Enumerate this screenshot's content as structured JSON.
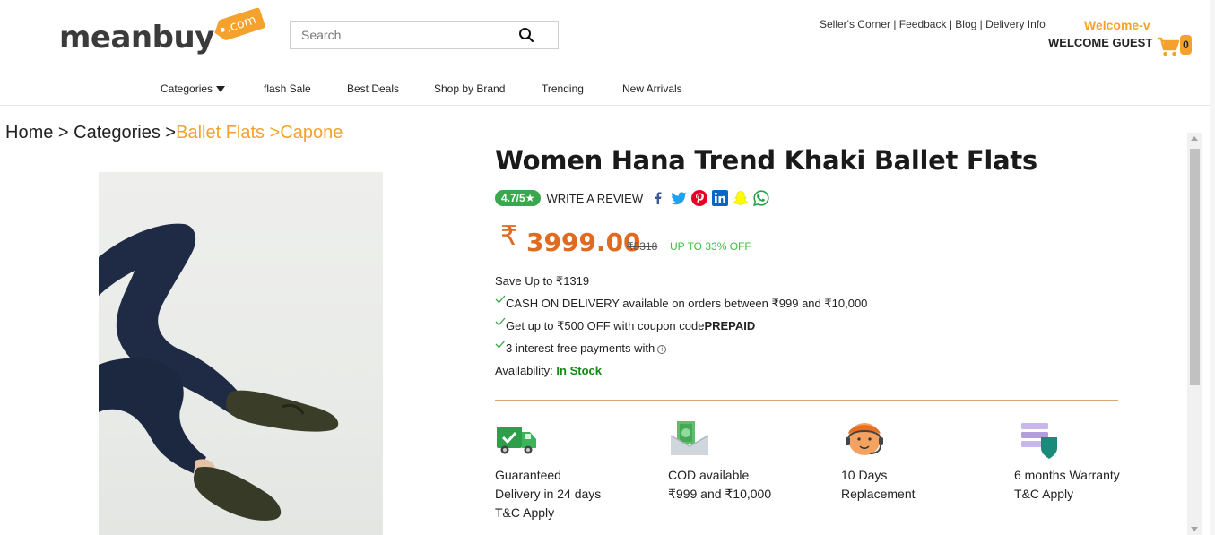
{
  "header": {
    "logo_text": "meanbuy",
    "logo_tag": ".com",
    "search_placeholder": "Search",
    "top_links": [
      "Seller's Corner",
      "Feedback",
      "Blog",
      "Delivery Info"
    ],
    "welcome": "Welcome-v",
    "guest": "WELCOME GUEST",
    "cart_count": "0",
    "accent_color": "#f4a22d"
  },
  "nav": {
    "items": [
      "Categories",
      "flash Sale",
      "Best Deals",
      "Shop by Brand",
      "Trending",
      "New Arrivals"
    ]
  },
  "breadcrumb": {
    "home": "Home",
    "sep1": " > ",
    "categories": "Categories",
    "sep2": " >",
    "ballet": "Ballet Flats",
    "sep3": " >",
    "brand": "Capone"
  },
  "product": {
    "title": "Women Hana Trend Khaki Ballet Flats",
    "rating": "4.7/5",
    "write_review": "WRITE A REVIEW",
    "social_icons": [
      "facebook-icon",
      "twitter-icon",
      "pinterest-icon",
      "linkedin-icon",
      "snapchat-icon",
      "whatsapp-icon"
    ],
    "currency": "₹",
    "price": "3999.00",
    "mrp": "₹5318",
    "offer": "UP TO 33% OFF",
    "save": "Save Up to ₹1319",
    "cod": "CASH ON DELIVERY available on orders between ₹999 and ₹10,000",
    "coupon_prefix": "Get up to ₹500 OFF with coupon code",
    "coupon_code": "PREPAID",
    "interest": "3 interest free payments with",
    "availability_label": "Availability: ",
    "availability_value": "In Stock"
  },
  "features": [
    {
      "icon": "delivery-truck-icon",
      "text": "Guaranteed Delivery in 24 days T&C Apply"
    },
    {
      "icon": "cash-envelope-icon",
      "text": "COD available ₹999 and ₹10,000"
    },
    {
      "icon": "support-agent-icon",
      "text": "10 Days Replacement"
    },
    {
      "icon": "warranty-shield-icon",
      "text": "6 months Warranty T&C Apply"
    }
  ]
}
